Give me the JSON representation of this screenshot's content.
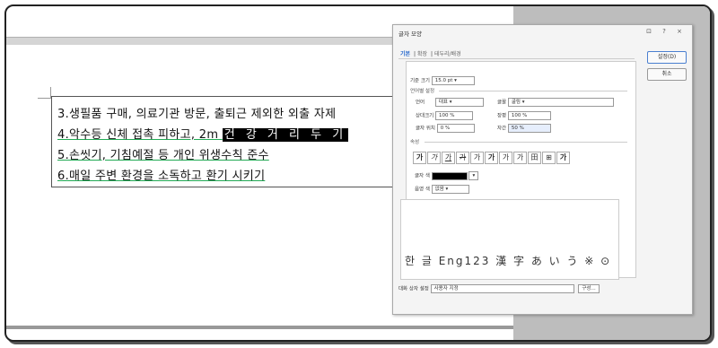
{
  "document": {
    "lines": [
      {
        "text": "3.생필품 구매, 의료기관 방문, 출퇴근 제외한 외출 자제"
      },
      {
        "prefix": "4.악수등 신체 접촉 피하고, 2m ",
        "selected": "건 강 거 리 두 기"
      },
      {
        "text": "5.손씻기, 기침예절 등 개인 위생수칙 준수"
      },
      {
        "text": "6.매일 주변 환경을 소독하고 환기 시키기"
      }
    ]
  },
  "dialog": {
    "title": "글자 모양",
    "controls": "⊡ ? ×",
    "tabs": [
      {
        "label": "기본",
        "active": true
      },
      {
        "label": "확장"
      },
      {
        "label": "테두리/배경"
      }
    ],
    "base_size_label": "기준 크기",
    "base_size_value": "15.0",
    "base_size_unit": "pt",
    "lang_section": "언어별 설정",
    "lang_label": "언어",
    "lang_value": "대표",
    "font_label": "글꼴",
    "font_value": "굴림",
    "rel_size_label": "상대크기",
    "rel_size_value": "100",
    "pct": "%",
    "spacing_label": "장평",
    "spacing_value": "100",
    "pos_label": "글자 위치",
    "pos_value": "0",
    "kerning_label": "자간",
    "kerning_value": "50",
    "attr_section": "속성",
    "attr_buttons": [
      "가",
      "가",
      "가",
      "가",
      "가",
      "가",
      "가",
      "가",
      "田",
      "⊞",
      "가"
    ],
    "font_color_label": "글자 색",
    "shade_color_label": "음영 색",
    "shade_color_value": "없음",
    "preview_text": "한 글 Eng123 漢 字 あ い う ※ ⊙",
    "ok_button": "설정(D)",
    "cancel_button": "취소",
    "dialog_setting_label": "대화 상자 설정",
    "dialog_setting_value": "사용자 지정",
    "config_button": "구성..."
  },
  "colors": {
    "selection_bg": "#000000",
    "accent": "#2266cc"
  }
}
